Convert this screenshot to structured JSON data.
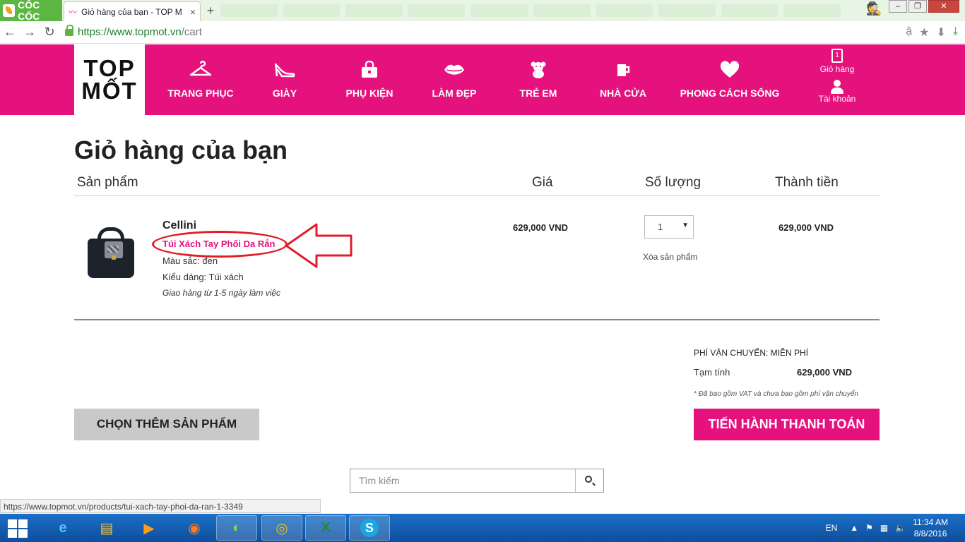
{
  "browser": {
    "brand": "CỐC CỐC",
    "tab_title": "Giỏ hàng của bạn - TOP M",
    "tab_close": "×",
    "newtab": "+",
    "url_domain": "https://www.topmot.vn",
    "url_path": "/cart",
    "win_min": "–",
    "win_max": "❐",
    "win_close": "✕",
    "status_url": "https://www.topmot.vn/products/tui-xach-tay-phoi-da-ran-1-3349"
  },
  "site": {
    "logo_line1": "TOP",
    "logo_line2": "MỐT",
    "nav": [
      {
        "label": "TRANG PHỤC",
        "icon": "hanger-icon"
      },
      {
        "label": "GIÀY",
        "icon": "heel-shoe-icon"
      },
      {
        "label": "PHỤ KIỆN",
        "icon": "handbag-icon"
      },
      {
        "label": "LÀM ĐẸP",
        "icon": "lips-icon"
      },
      {
        "label": "TRẺ EM",
        "icon": "teddy-bear-icon"
      },
      {
        "label": "NHÀ CỬA",
        "icon": "mug-icon"
      },
      {
        "label": "PHONG CÁCH SỐNG",
        "icon": "heart-icon"
      }
    ],
    "cart_label": "Giỏ hàng",
    "cart_count": "1",
    "account_label": "Tài khoản",
    "brand_color": "#e5117d"
  },
  "cart": {
    "title": "Giỏ hàng của bạn",
    "headers": {
      "product": "Sản phẩm",
      "price": "Giá",
      "quantity": "Số lượng",
      "total": "Thành tiền"
    },
    "item": {
      "brand": "Cellini",
      "name": "Túi Xách Tay Phối Da Rắn",
      "color": "Màu sắc: đen",
      "style": "Kiểu dáng: Túi xách",
      "delivery": "Giao hàng từ 1-5 ngày làm việc",
      "price": "629,000 VND",
      "quantity": "1",
      "remove": "Xóa sản phẩm",
      "line_total": "629,000 VND"
    },
    "shipping": "PHÍ VẬN CHUYỂN: MIỄN PHÍ",
    "subtotal_label": "Tạm tính",
    "subtotal_value": "629,000 VND",
    "vat_note": "* Đã bao gồm VAT và chưa bao gồm phí vận chuyển",
    "continue_button": "CHỌN THÊM SẢN PHẨM",
    "checkout_button": "TIẾN HÀNH THANH TOÁN"
  },
  "search": {
    "placeholder": "Tìm kiếm"
  },
  "taskbar": {
    "lang": "EN",
    "time": "11:34 AM",
    "date": "8/8/2016"
  }
}
